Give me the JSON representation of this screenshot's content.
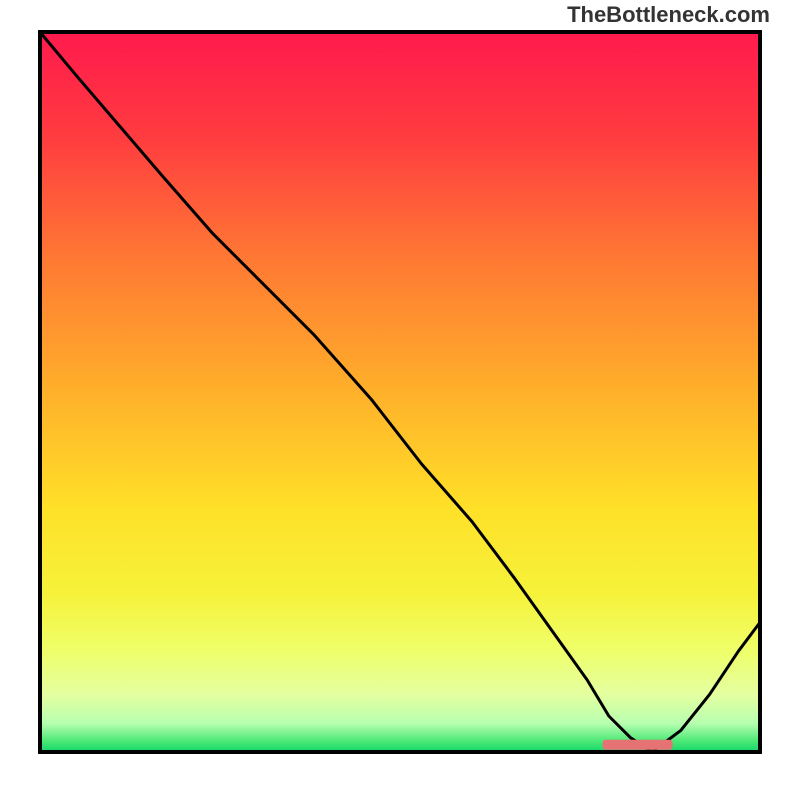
{
  "attribution": "TheBottleneck.com",
  "chart_data": {
    "type": "line",
    "title": "",
    "xlabel": "",
    "ylabel": "",
    "xlim": [
      0,
      100
    ],
    "ylim": [
      0,
      100
    ],
    "series": [
      {
        "name": "bottleneck-curve",
        "x": [
          0,
          5,
          11,
          17,
          24,
          30,
          38,
          46,
          53,
          60,
          66,
          71,
          76,
          79,
          82,
          85,
          89,
          93,
          97,
          100
        ],
        "y": [
          100,
          94,
          87,
          80,
          72,
          66,
          58,
          49,
          40,
          32,
          24,
          17,
          10,
          5,
          2,
          0,
          3,
          8,
          14,
          18
        ]
      }
    ],
    "marker": {
      "x": 83,
      "y": 1,
      "label": ""
    },
    "gradient_stops": [
      {
        "pct": 0.0,
        "color": "#ff1a4d"
      },
      {
        "pct": 0.14,
        "color": "#ff3a40"
      },
      {
        "pct": 0.32,
        "color": "#ff7a33"
      },
      {
        "pct": 0.5,
        "color": "#ffb02a"
      },
      {
        "pct": 0.66,
        "color": "#ffe028"
      },
      {
        "pct": 0.78,
        "color": "#f6f23a"
      },
      {
        "pct": 0.86,
        "color": "#efff6a"
      },
      {
        "pct": 0.92,
        "color": "#e4ffa0"
      },
      {
        "pct": 0.96,
        "color": "#b8ffb0"
      },
      {
        "pct": 0.985,
        "color": "#4be876"
      },
      {
        "pct": 1.0,
        "color": "#12d66a"
      }
    ]
  }
}
